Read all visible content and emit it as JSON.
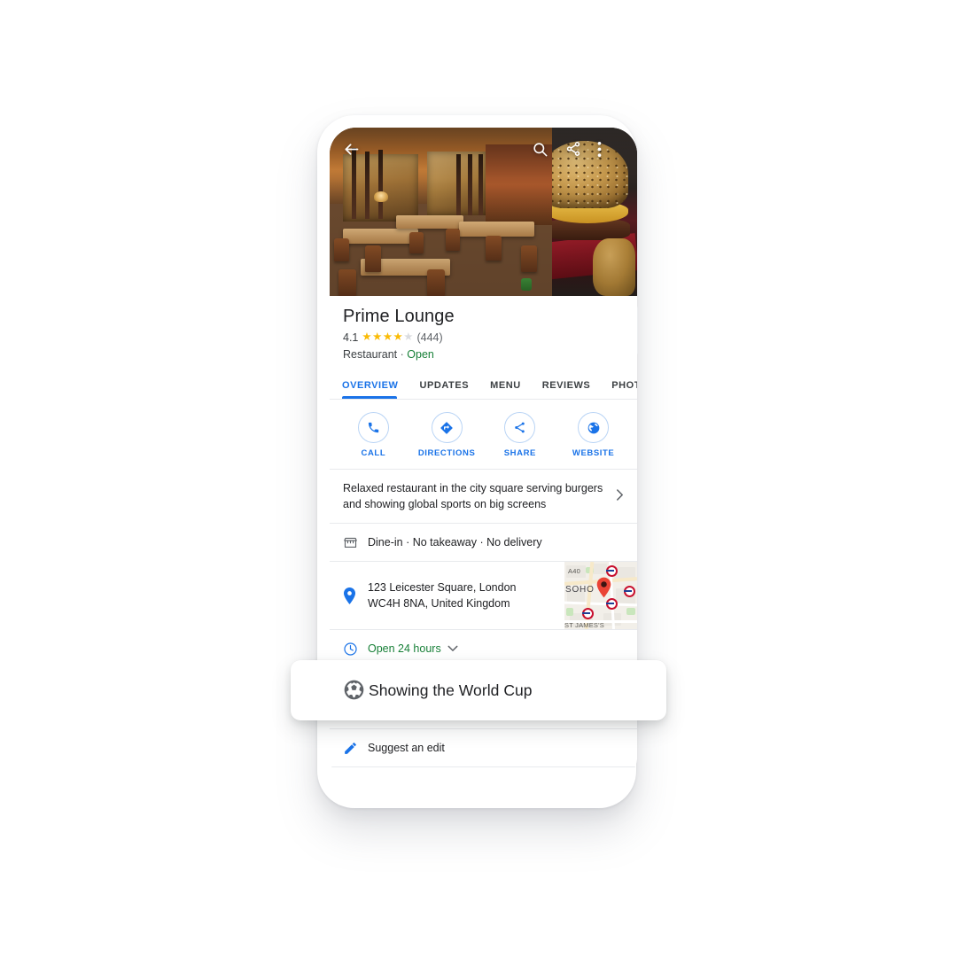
{
  "app": {
    "name": "Google Maps place page",
    "accent_color": "#1a73e8",
    "open_color": "#188038",
    "star_color": "#fabb05"
  },
  "header": {
    "back_icon": "back-arrow-icon",
    "search_icon": "search-icon",
    "share_icon": "share-icon",
    "overflow_icon": "more-vertical-icon",
    "photos": [
      {
        "name": "restaurant-interior-photo"
      },
      {
        "name": "burger-photo"
      }
    ]
  },
  "place": {
    "name": "Prime Lounge",
    "rating": "4.1",
    "stars_filled": 4,
    "stars_total": 5,
    "review_count": "(444)",
    "category": "Restaurant",
    "separator": "·",
    "status": "Open"
  },
  "tabs": [
    {
      "label": "OVERVIEW",
      "active": true
    },
    {
      "label": "UPDATES",
      "active": false
    },
    {
      "label": "MENU",
      "active": false
    },
    {
      "label": "REVIEWS",
      "active": false
    },
    {
      "label": "PHOTOS",
      "active": false
    }
  ],
  "actions": [
    {
      "label": "CALL",
      "icon": "phone-icon"
    },
    {
      "label": "DIRECTIONS",
      "icon": "directions-icon"
    },
    {
      "label": "SHARE",
      "icon": "share-icon"
    },
    {
      "label": "WEBSITE",
      "icon": "globe-icon"
    }
  ],
  "info": {
    "description": "Relaxed restaurant in the city square serving burgers and showing global sports on big screens",
    "description_chevron": "chevron-right-icon",
    "service_options": "Dine-in · No takeaway · No delivery",
    "service_icon": "storefront-icon",
    "address_line1": "123 Leicester Square, London",
    "address_line2": "WC4H 8NA, United Kingdom",
    "address_icon": "map-pin-icon",
    "hours": "Open 24 hours",
    "hours_icon": "clock-icon",
    "hours_chevron": "chevron-down-icon",
    "suggest_edit": "Suggest an edit",
    "suggest_edit_icon": "pencil-icon"
  },
  "map_thumbnail": {
    "labels": [
      "A40",
      "SOHO",
      "ST JAMES'S"
    ],
    "pin_icon": "map-marker-icon",
    "transit_icon": "tube-roundel-icon"
  },
  "floating_card": {
    "label": "Showing the World Cup",
    "icon": "soccer-ball-icon"
  }
}
